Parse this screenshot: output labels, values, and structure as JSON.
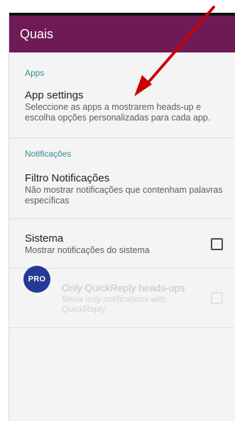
{
  "appbar": {
    "title": "Quais"
  },
  "sections": {
    "apps": {
      "header": "Apps",
      "app_settings": {
        "title": "App settings",
        "subtitle": "Seleccione as apps a mostrarem heads-up e escolha opções personalizadas para cada app."
      }
    },
    "notifications": {
      "header": "Notificações",
      "filter": {
        "title": "Filtro Notificações",
        "subtitle": "Não mostrar notificações que contenham palavras específicas"
      },
      "system": {
        "title": "Sistema",
        "subtitle": "Mostrar notificações do sistema",
        "checked": false
      },
      "quickreply": {
        "badge": "PRO",
        "title": "Only QuickReply heads-ups",
        "subtitle": "Show only notifications with QuickReply",
        "checked": false,
        "enabled": false
      }
    }
  },
  "colors": {
    "appbar": "#6f1a55",
    "section_header": "#2f8d94",
    "pro_badge": "#243a96",
    "annotation_arrow": "#cc0000"
  }
}
